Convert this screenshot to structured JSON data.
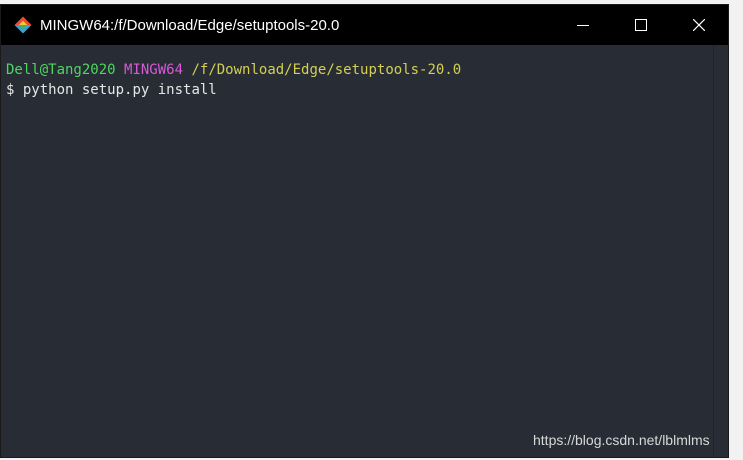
{
  "window": {
    "title": "MINGW64:/f/Download/Edge/setuptools-20.0",
    "icon": "git-bash-icon",
    "controls": {
      "minimize": "minimize-icon",
      "maximize": "maximize-icon",
      "close": "close-icon"
    }
  },
  "terminal": {
    "prompt": {
      "user_host": "Dell@Tang2020",
      "env": "MINGW64",
      "path": "/f/Download/Edge/setuptools-20.0"
    },
    "symbol": "$",
    "command": "python setup.py install"
  },
  "colors": {
    "background": "#282c35",
    "titlebar": "#000000",
    "user_host": "#4ed760",
    "env": "#d65ad6",
    "path": "#d4cf54",
    "text": "#e6e6e6"
  },
  "watermark": "https://blog.csdn.net/lblmlms"
}
